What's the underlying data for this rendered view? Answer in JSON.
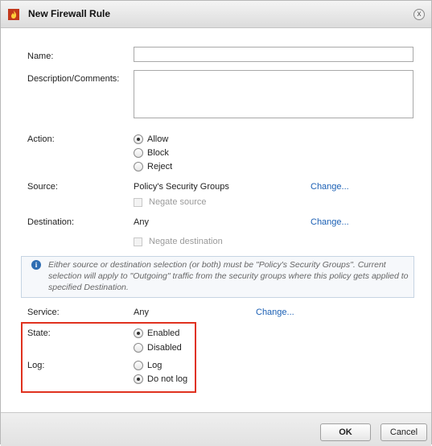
{
  "dialog": {
    "title": "New Firewall Rule",
    "close_icon": "close-icon",
    "title_icon": "firewall-icon"
  },
  "form": {
    "name_label": "Name:",
    "name_value": "",
    "description_label": "Description/Comments:",
    "description_value": "",
    "action_label": "Action:",
    "action_options": [
      "Allow",
      "Block",
      "Reject"
    ],
    "action_selected": "Allow",
    "source_label": "Source:",
    "source_value": "Policy's Security Groups",
    "source_change": "Change...",
    "negate_source_label": "Negate source",
    "destination_label": "Destination:",
    "destination_value": "Any",
    "destination_change": "Change...",
    "negate_destination_label": "Negate destination",
    "info_text": "Either source or destination selection (or both) must be \"Policy's Security Groups\". Current selection will apply to \"Outgoing\" traffic from the security groups where this policy gets applied to specified Destination.",
    "service_label": "Service:",
    "service_value": "Any",
    "service_change": "Change...",
    "state_label": "State:",
    "state_options": [
      "Enabled",
      "Disabled"
    ],
    "state_selected": "Enabled",
    "log_label": "Log:",
    "log_options": [
      "Log",
      "Do not log"
    ],
    "log_selected": "Do not log"
  },
  "footer": {
    "ok_label": "OK",
    "cancel_label": "Cancel"
  },
  "colors": {
    "highlight": "#e0321f",
    "link": "#1a5fb4",
    "info_icon": "#2f6db2"
  }
}
